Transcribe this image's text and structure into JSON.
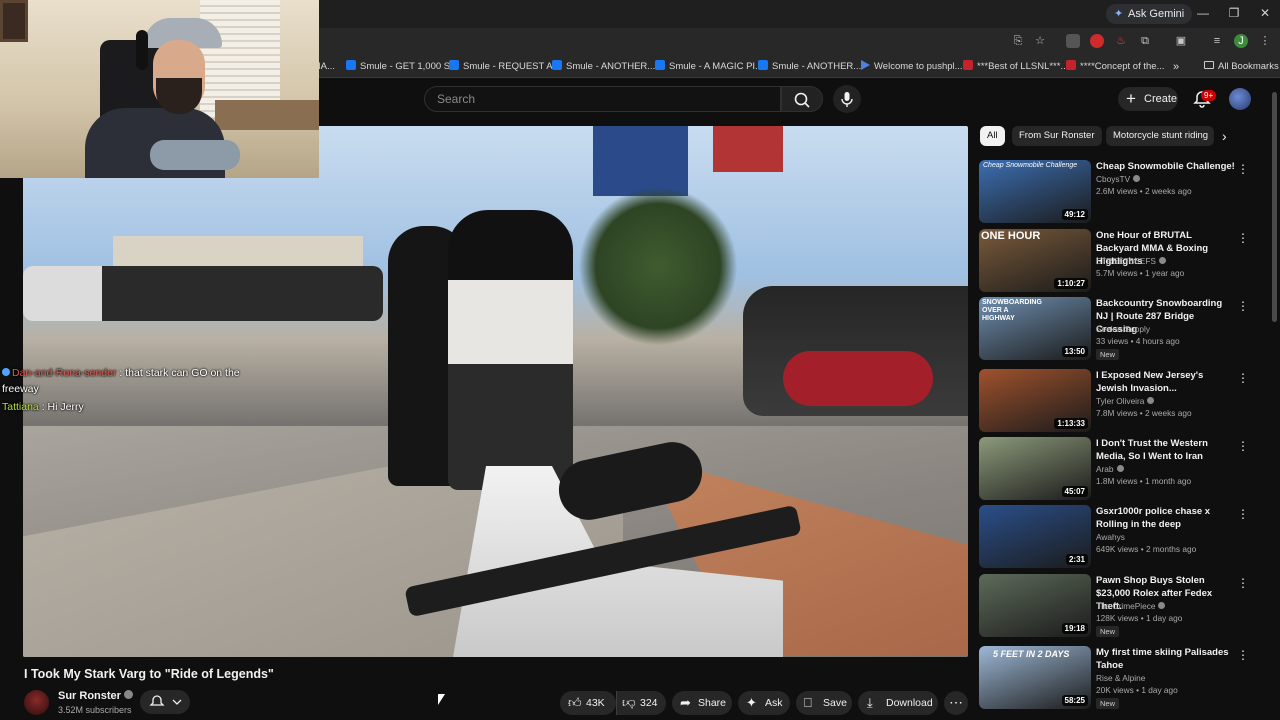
{
  "browser": {
    "ask_gemini": "Ask Gemini",
    "bookmarks": [
      {
        "label": "IA...",
        "fav": "none"
      },
      {
        "label": "Smule - GET 1,000 S...",
        "fav": "fb"
      },
      {
        "label": "Smule - REQUEST A...",
        "fav": "fb"
      },
      {
        "label": "Smule - ANOTHER...",
        "fav": "fb"
      },
      {
        "label": "Smule - A MAGIC PI...",
        "fav": "fb"
      },
      {
        "label": "Smule - ANOTHER...",
        "fav": "fb"
      },
      {
        "label": "Welcome to pushpl...",
        "fav": "push"
      },
      {
        "label": "***Best of LLSNL***...",
        "fav": "red"
      },
      {
        "label": "****Concept of the...",
        "fav": "red"
      }
    ],
    "bookmarks_overflow": "»",
    "all_bookmarks": "All Bookmarks"
  },
  "youtube": {
    "search_placeholder": "Search",
    "create_label": "Create",
    "notification_count": "9+"
  },
  "chat": [
    {
      "user": "Dan-and-Rona-sender",
      "message": ": that stark can GO on the",
      "color": "#e0584f"
    },
    {
      "user": "",
      "message": "freeway",
      "color": ""
    },
    {
      "user": "Tattiana",
      "message": ": Hi Jerry",
      "color": "#b7e03b"
    }
  ],
  "video": {
    "title": "I Took My Stark Varg to \"Ride of Legends\"",
    "channel": "Sur Ronster",
    "subscribers": "3.52M subscribers",
    "likes": "43K",
    "dislikes": "324",
    "share": "Share",
    "ask": "Ask",
    "save": "Save",
    "download": "Download"
  },
  "chips": [
    "All",
    "From Sur Ronster",
    "Motorcycle stunt riding"
  ],
  "recommendations": [
    {
      "title": "Cheap Snowmobile Challenge!",
      "channel": "CboysTV",
      "verified": true,
      "meta": "2.6M views • 2 weeks ago",
      "duration": "49:12",
      "new": false,
      "thumb": "#3c6fb3"
    },
    {
      "title": "One Hour of BRUTAL Backyard MMA & Boxing Highlights",
      "channel": "STREETBEEFS",
      "verified": true,
      "meta": "5.7M views • 1 year ago",
      "duration": "1:10:27",
      "new": false,
      "thumb": "#7a5a3a"
    },
    {
      "title": "Backcountry Snowboarding NJ | Route 287 Bridge Crossing",
      "channel": "Seeker Supply",
      "verified": false,
      "meta": "33 views • 4 hours ago",
      "duration": "13:50",
      "new": true,
      "thumb": "#6f8fb0"
    },
    {
      "title": "I Exposed New Jersey's Jewish Invasion...",
      "channel": "Tyler Oliveira",
      "verified": true,
      "meta": "7.8M views • 2 weeks ago",
      "duration": "1:13:33",
      "new": false,
      "thumb": "#a0522d"
    },
    {
      "title": "I Don't Trust the Western Media, So I Went to Iran",
      "channel": "Arab",
      "verified": true,
      "meta": "1.8M views • 1 month ago",
      "duration": "45:07",
      "new": false,
      "thumb": "#8c9a7a"
    },
    {
      "title": "Gsxr1000r police chase x Rolling in the deep",
      "channel": "Awahys",
      "verified": false,
      "meta": "649K views • 2 months ago",
      "duration": "2:31",
      "new": false,
      "thumb": "#2a4f8a"
    },
    {
      "title": "Pawn Shop Buys Stolen $23,000 Rolex after Fedex Theft.",
      "channel": "The CrimePiece",
      "verified": true,
      "meta": "128K views • 1 day ago",
      "duration": "19:18",
      "new": true,
      "thumb": "#5d6b5a"
    },
    {
      "title": "My first time skiing Palisades Tahoe",
      "channel": "Rise & Alpine",
      "verified": false,
      "meta": "20K views • 1 day ago",
      "duration": "58:25",
      "new": true,
      "thumb": "#9db8d6"
    }
  ],
  "labels": {
    "new": "New"
  },
  "thumb_captions": [
    "Cheap Snowmobile Challenge",
    "ONE HOUR",
    "SNOWBOARDING OVER A HIGHWAY",
    "5 FEET IN 2 DAYS"
  ]
}
